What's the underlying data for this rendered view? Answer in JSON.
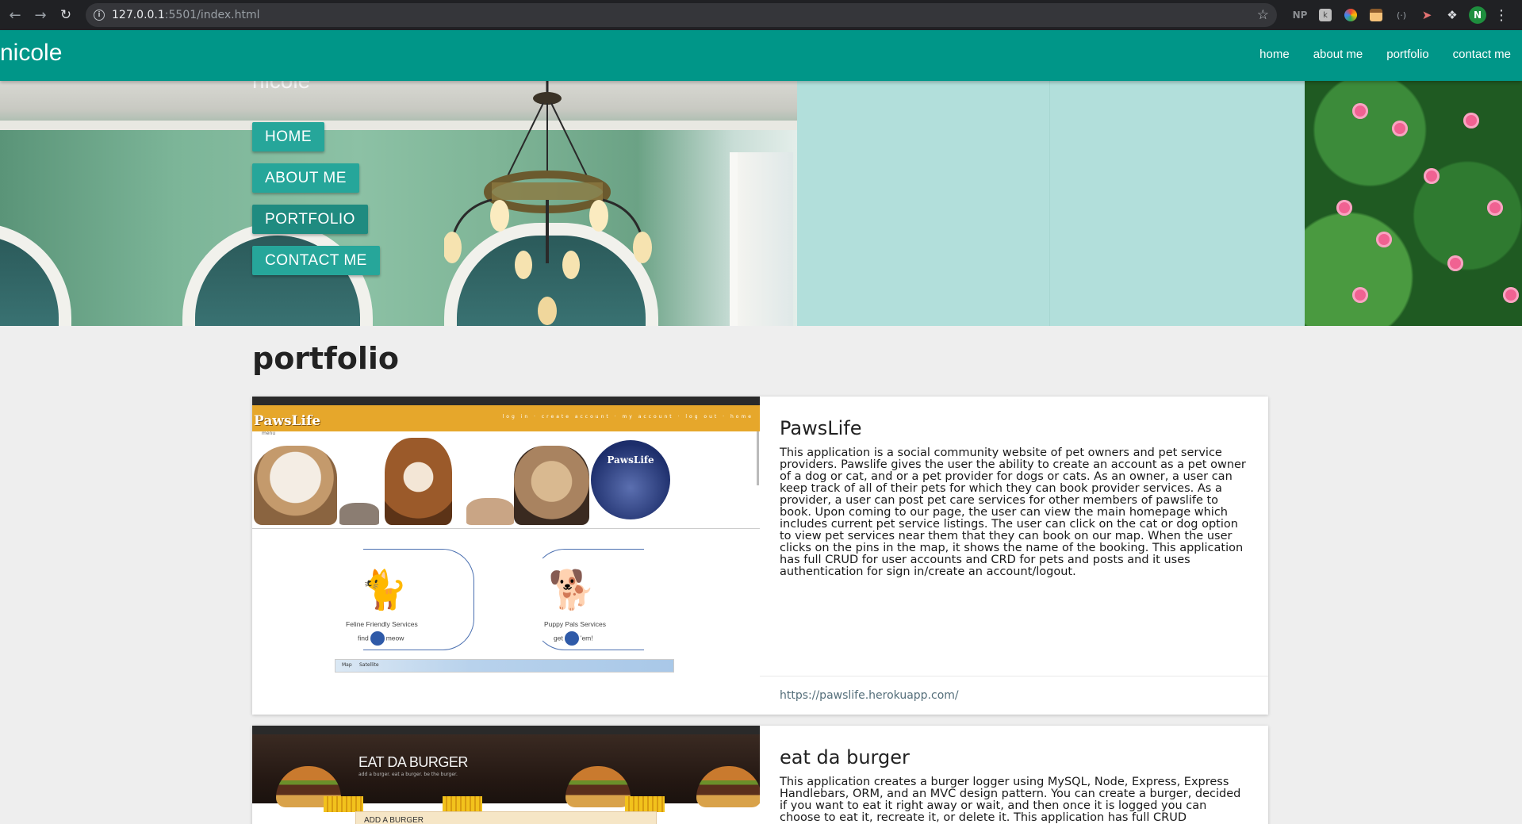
{
  "browser": {
    "url_host": "127.0.0.1",
    "url_path": ":5501/index.html",
    "extensions": [
      "NP"
    ],
    "profile_initial": "N"
  },
  "navbar": {
    "brand": "nicole",
    "links": [
      "home",
      "about me",
      "portfolio",
      "contact me"
    ]
  },
  "hero": {
    "ghost_title": "nicole",
    "menu": [
      "HOME",
      "ABOUT ME",
      "PORTFOLIO",
      "CONTACT ME"
    ],
    "active_index": 2
  },
  "main": {
    "title": "portfolio",
    "projects": [
      {
        "title": "PawsLife",
        "description": "This application is a social community website of pet owners and pet service providers. Pawslife gives the user the ability to create an account as a pet owner of a dog or cat, and or a pet provider for dogs or cats. As an owner, a user can keep track of all of their pets for which they can book provider services. As a provider, a user can post pet care services for other members of pawslife to book. Upon coming to our page, the user can view the main homepage which includes current pet service listings. The user can click on the cat or dog option to view pet services near them that they can book on our map. When the user clicks on the pins in the map, it shows the name of the booking. This application has full CRUD for user accounts and CRD for pets and posts and it uses authentication for sign in/create an account/logout.",
        "link": "https://pawslife.herokuapp.com/",
        "screenshot": {
          "logo": "PawsLife",
          "menu": "menu",
          "nav_icons": "log in · create account · my account · log out · home",
          "service_left": "Feline Friendly Services",
          "service_left_cta_a": "find",
          "service_left_cta_b": "meow",
          "service_right": "Puppy Pals Services",
          "service_right_cta_a": "get",
          "service_right_cta_b": "'em!",
          "map_tab": "Map",
          "satellite_tab": "Satellite"
        }
      },
      {
        "title": "eat da burger",
        "description": "This application creates a burger logger using MySQL, Node, Express, Express Handlebars, ORM, and an MVC design pattern. You can create a burger, decided if you want to eat it right away or wait, and then once it is logged you can choose to eat it, recreate it, or delete it. This application has full CRUD functionality. This application is",
        "screenshot": {
          "title": "EAT DA BURGER",
          "subtitle": "add a burger. eat a burger. be the burger.",
          "form_label": "ADD A BURGER"
        }
      }
    ]
  }
}
